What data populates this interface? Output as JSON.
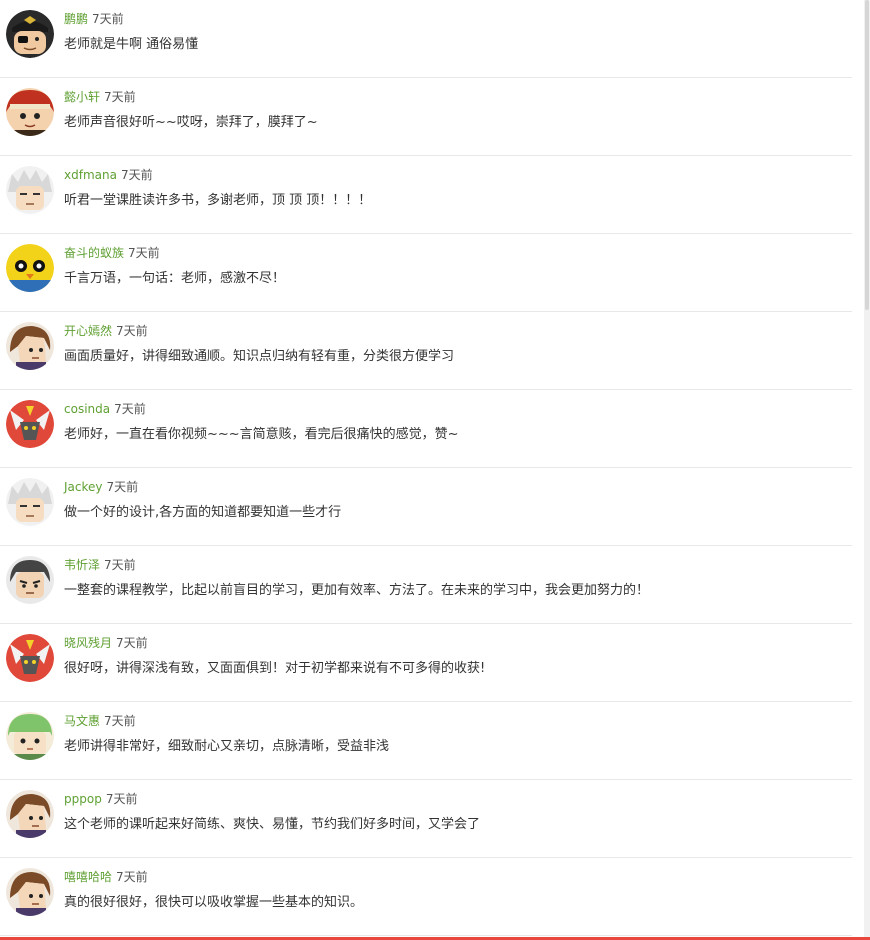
{
  "comments": [
    {
      "user": "鹏鹏",
      "time": "7天前",
      "text": "老师就是牛啊 通俗易懂",
      "avatar": "pirate-avatar-icon"
    },
    {
      "user": "懿小轩",
      "time": "7天前",
      "text": "老师声音很好听~~哎呀，崇拜了，膜拜了~",
      "avatar": "red-hair-avatar-icon"
    },
    {
      "user": "xdfmana",
      "time": "7天前",
      "text": "听君一堂课胜读许多书，多谢老师，顶 顶 顶！！！！",
      "avatar": "white-hair-avatar-icon"
    },
    {
      "user": "奋斗的蚁族",
      "time": "7天前",
      "text": "千言万语，一句话：老师，感激不尽！",
      "avatar": "yellow-robot-avatar-icon"
    },
    {
      "user": "开心嫣然",
      "time": "7天前",
      "text": "画面质量好，讲得细致通顺。知识点归纳有轻有重，分类很方便学习",
      "avatar": "brown-hair-avatar-icon"
    },
    {
      "user": "cosinda",
      "time": "7天前",
      "text": "老师好，一直在看你视频~~~言简意赅，看完后很痛快的感觉，赞~",
      "avatar": "red-mecha-avatar-icon"
    },
    {
      "user": "Jackey",
      "time": "7天前",
      "text": "做一个好的设计,各方面的知道都要知道一些才行",
      "avatar": "white-hair-avatar-icon"
    },
    {
      "user": "韦忻泽",
      "time": "7天前",
      "text": "一整套的课程教学，比起以前盲目的学习，更加有效率、方法了。在未来的学习中，我会更加努力的！",
      "avatar": "dark-hair-avatar-icon"
    },
    {
      "user": "晓风残月",
      "time": "7天前",
      "text": "很好呀，讲得深浅有致，又面面俱到！对于初学都来说有不可多得的收获!",
      "avatar": "red-mecha-avatar-icon"
    },
    {
      "user": "马文惠",
      "time": "7天前",
      "text": "老师讲得非常好，细致耐心又亲切，点脉清晰，受益非浅",
      "avatar": "green-hair-avatar-icon"
    },
    {
      "user": "pppop",
      "time": "7天前",
      "text": "这个老师的课听起来好简练、爽快、易懂，节约我们好多时间，又学会了",
      "avatar": "brown-hair-avatar-icon"
    },
    {
      "user": "嘻嘻哈哈",
      "time": "7天前",
      "text": "真的很好很好，很快可以吸收掌握一些基本的知识。",
      "avatar": "brown-hair-avatar-icon"
    }
  ],
  "colors": {
    "username": "#5fa033",
    "text": "#333333",
    "divider": "#e8e8e8",
    "bottom_accent": "#e8483e"
  }
}
